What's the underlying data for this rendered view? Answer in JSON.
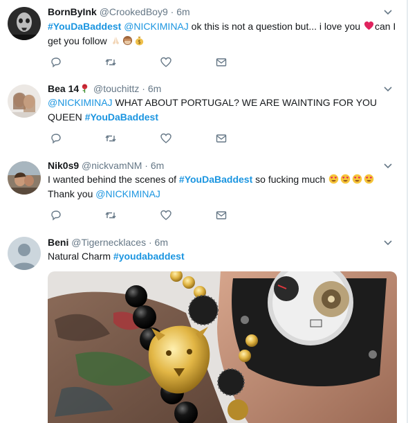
{
  "tweets": [
    {
      "name": "BornByInk",
      "handle": "@CrookedBoy9",
      "sep": "·",
      "time": "6m",
      "segments": [
        {
          "text": "#YouDaBaddest",
          "kind": "hashtag"
        },
        {
          "text": " ",
          "kind": "plain"
        },
        {
          "text": "@NICKIMINAJ",
          "kind": "link"
        },
        {
          "text": " ok this is not a question but... i love you ",
          "kind": "plain"
        },
        {
          "emoji": "heart",
          "kind": "emoji"
        },
        {
          "text": "can I get you follow ",
          "kind": "plain"
        },
        {
          "emoji": "pray",
          "kind": "emoji"
        },
        {
          "emoji": "see-no-evil",
          "kind": "emoji"
        },
        {
          "emoji": "money-bag",
          "kind": "emoji"
        }
      ]
    },
    {
      "name": "Bea 14",
      "name_emoji": "rose",
      "handle": "@touchittz",
      "sep": "·",
      "time": "6m",
      "segments": [
        {
          "text": "@NICKIMINAJ",
          "kind": "link"
        },
        {
          "text": " WHAT ABOUT PORTUGAL? WE ARE WAINTING FOR YOU QUEEN ",
          "kind": "plain"
        },
        {
          "text": "#YouDaBaddest",
          "kind": "hashtag"
        }
      ]
    },
    {
      "name": "Nik0s9",
      "handle": "@nickvamNM",
      "sep": "·",
      "time": "6m",
      "segments": [
        {
          "text": "I wanted behind the scenes of ",
          "kind": "plain"
        },
        {
          "text": "#YouDaBaddest",
          "kind": "hashtag"
        },
        {
          "text": " so fucking much ",
          "kind": "plain"
        },
        {
          "emoji": "heart-eyes",
          "kind": "emoji"
        },
        {
          "emoji": "heart-eyes",
          "kind": "emoji"
        },
        {
          "emoji": "heart-eyes",
          "kind": "emoji"
        },
        {
          "emoji": "heart-eyes",
          "kind": "emoji"
        },
        {
          "text": " Thank you ",
          "kind": "plain"
        },
        {
          "text": "@NICKIMINAJ",
          "kind": "link"
        }
      ]
    },
    {
      "name": "Beni",
      "handle": "@Tigernecklaces",
      "sep": "·",
      "time": "6m",
      "segments": [
        {
          "text": "Natural Charm ",
          "kind": "plain"
        },
        {
          "text": "#youdabaddest",
          "kind": "hashtag"
        }
      ]
    }
  ],
  "icons": {
    "reply": "reply-icon",
    "retweet": "retweet-icon",
    "like": "like-icon",
    "message": "direct-message-icon",
    "caret": "chevron-down-icon"
  },
  "colors": {
    "link": "#1b95e0",
    "secondary_text": "#657786",
    "divider": "#e6ecf0",
    "heart": "#e0245e"
  }
}
